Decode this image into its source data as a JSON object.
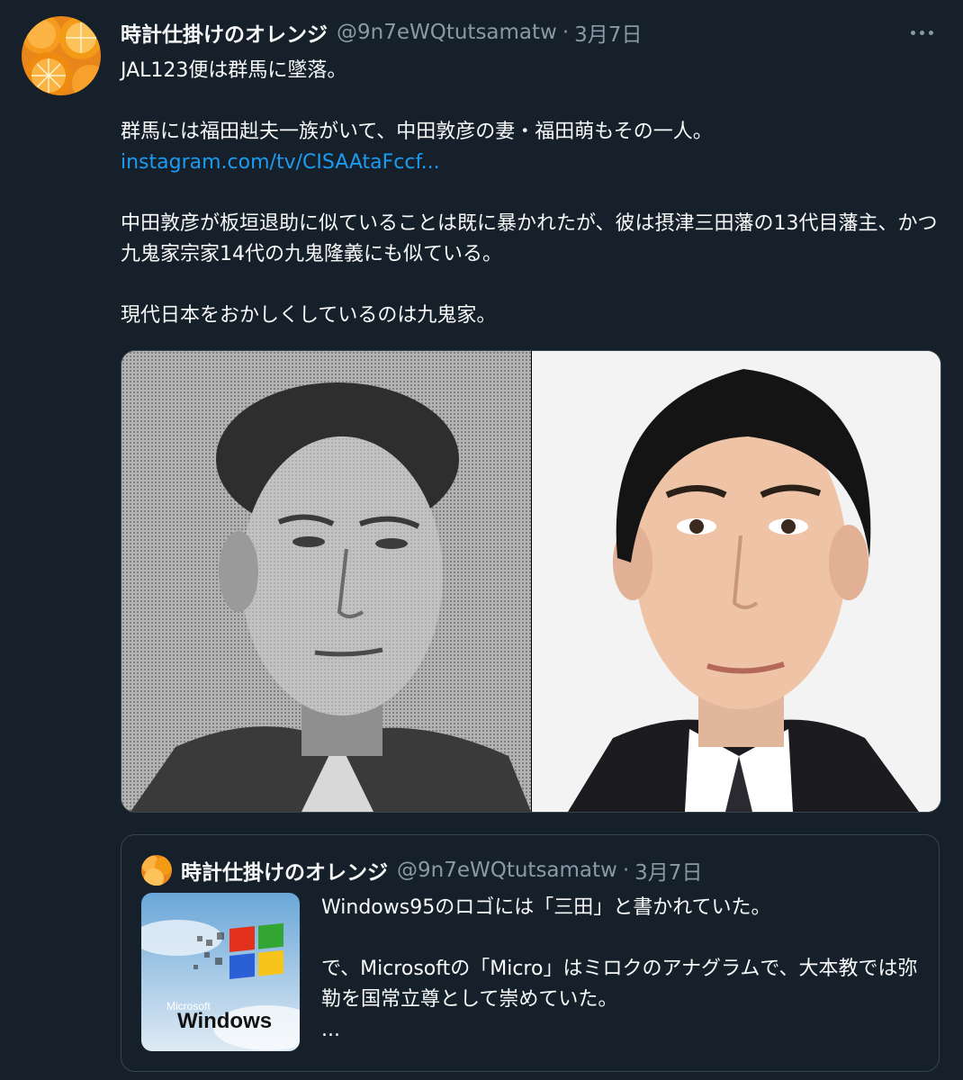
{
  "tweet": {
    "display_name": "時計仕掛けのオレンジ",
    "handle": "@9n7eWQtutsamatw",
    "separator": "·",
    "date": "3月7日",
    "more_icon": "more-horizontal-icon",
    "lines": [
      "JAL123便は群馬に墜落。",
      "群馬には福田赳夫一族がいて、中田敦彦の妻・福田萌もその一人。",
      "中田敦彦が板垣退助に似ていることは既に暴かれたが、彼は摂津三田藩の13代目藩主、かつ九鬼家宗家14代の九鬼隆義にも似ている。",
      "現代日本をおかしくしているのは九鬼家。"
    ],
    "link": "instagram.com/tv/CISAAtaFccf..."
  },
  "quote": {
    "display_name": "時計仕掛けのオレンジ",
    "handle": "@9n7eWQtutsamatw",
    "separator": "·",
    "date": "3月7日",
    "thumbnail_label": "Microsoft",
    "thumbnail_label_2": "Windows",
    "lines": [
      "Windows95のロゴには「三田」と書かれていた。",
      "で、Microsoftの「Micro」はミロクのアナグラムで、大本教では弥勒を国常立尊として崇めていた。",
      "..."
    ]
  }
}
